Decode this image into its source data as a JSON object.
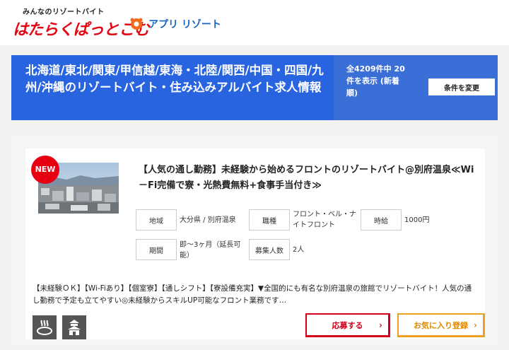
{
  "header": {
    "logo_sub": "みんなのリゾートバイト",
    "logo_main": "はたらくぱっとこむ",
    "app_label": "アプリ リゾート"
  },
  "banner": {
    "title": "北海道/東北/関東/甲信越/東海・北陸/関西/中国・四国/九州/沖縄のリゾートバイト・住み込みアルバイト求人情報",
    "count_text": "全4209件中 20件を表示 (新着順)",
    "change_button": "条件を変更"
  },
  "job": {
    "badge": "NEW",
    "title": "【人気の通し勤務】未経験から始めるフロントのリゾートバイト@別府温泉≪Wi－Fi完備で寮・光熱費無料+食事手当付き≫",
    "fields": {
      "area_label": "地域",
      "area_value": "大分県 / 別府温泉",
      "job_label": "職種",
      "job_value": "フロント・ベル・ナイトフロント",
      "wage_label": "時給",
      "wage_value": "1000円",
      "period_label": "期間",
      "period_value": "即〜3ヶ月（延長可能）",
      "recruit_label": "募集人数",
      "recruit_value": "2人"
    },
    "description": "【未経験ＯＫ】【Wi-Fiあり】【個室寮】【通しシフト】【寮設備充実】▼全国的にも有名な別府温泉の旅館でリゾートバイト！人気の通し勤務で予定も立てやすい◎未経験からスキルUP可能なフロント業務です…",
    "icons": [
      "hot-spring-icon",
      "ryokan-icon"
    ],
    "apply_button": "応募する",
    "fav_button": "お気に入り登録"
  },
  "colors": {
    "brand_red": "#e30613",
    "banner_blue": "#2864e0",
    "apply_red": "#d4001a",
    "fav_orange": "#f0a020"
  }
}
